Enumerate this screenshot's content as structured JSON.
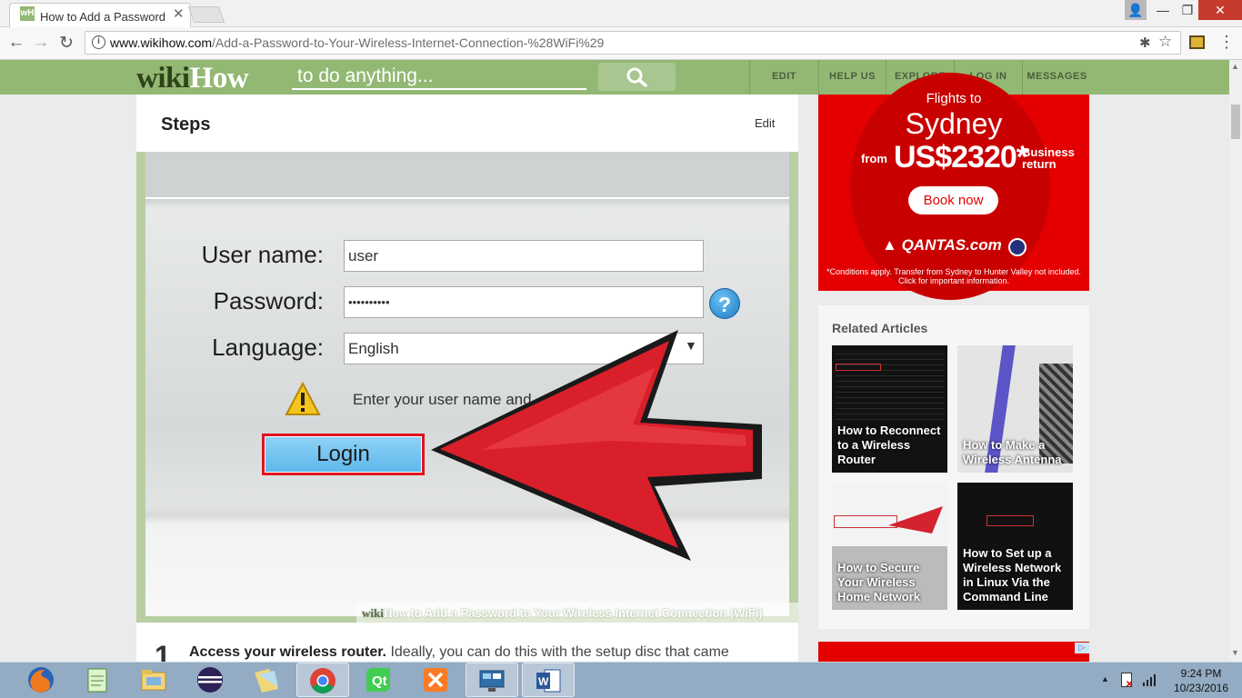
{
  "browser": {
    "tab_title": "How to Add a Password",
    "tab_favicon": "wH",
    "url_domain": "www.wikihow.com",
    "url_path": "/Add-a-Password-to-Your-Wireless-Internet-Connection-%28WiFi%29"
  },
  "wikihow": {
    "logo_wiki": "wiki",
    "logo_how": "How",
    "search_placeholder": "to do anything...",
    "nav": [
      "EDIT",
      "HELP US",
      "EXPLORE",
      "LOG IN",
      "MESSAGES"
    ]
  },
  "article": {
    "section_title": "Steps",
    "edit_label": "Edit",
    "image": {
      "username_label": "User name:",
      "username_value": "user",
      "password_label": "Password:",
      "password_value": "••••••••••",
      "language_label": "Language:",
      "language_value": "English",
      "warning_text": "Enter your user name and",
      "login_button": "Login",
      "caption_wiki": "wiki",
      "caption_how": "How",
      "caption_text": " to Add a Password to Your Wireless Internet Connection (WiFi)"
    },
    "step_number": "1",
    "step_bold": "Access your wireless router.",
    "step_text": " Ideally, you can do this with the setup disc that came"
  },
  "ad": {
    "flights": "Flights to",
    "city": "Sydney",
    "from": "from",
    "price": "US$2320*",
    "class_line1": "Business",
    "class_line2": "return",
    "book": "Book now",
    "logo": "QANTAS.com",
    "conditions": "*Conditions apply. Transfer from Sydney to Hunter Valley not included. Click for important information."
  },
  "related": {
    "heading": "Related Articles",
    "items": [
      {
        "title": "How to Reconnect to a Wireless Router"
      },
      {
        "title": "How to Make a Wireless Antenna"
      },
      {
        "title": "How to Secure Your Wireless Home Network"
      },
      {
        "title": "How to Set up a Wireless Network in Linux Via the Command Line"
      }
    ]
  },
  "taskbar": {
    "apps": [
      "firefox-icon",
      "notepadpp-icon",
      "file-explorer-icon",
      "eclipse-icon",
      "folder-icon",
      "chrome-icon",
      "qt-creator-icon",
      "xampp-icon",
      "remote-desktop-icon",
      "word-icon"
    ],
    "time": "9:24 PM",
    "date": "10/23/2016"
  },
  "colors": {
    "wikihow_green": "#93b874",
    "ad_red": "#e40000",
    "login_red": "#e0131f",
    "taskbar": "#93abc3"
  }
}
